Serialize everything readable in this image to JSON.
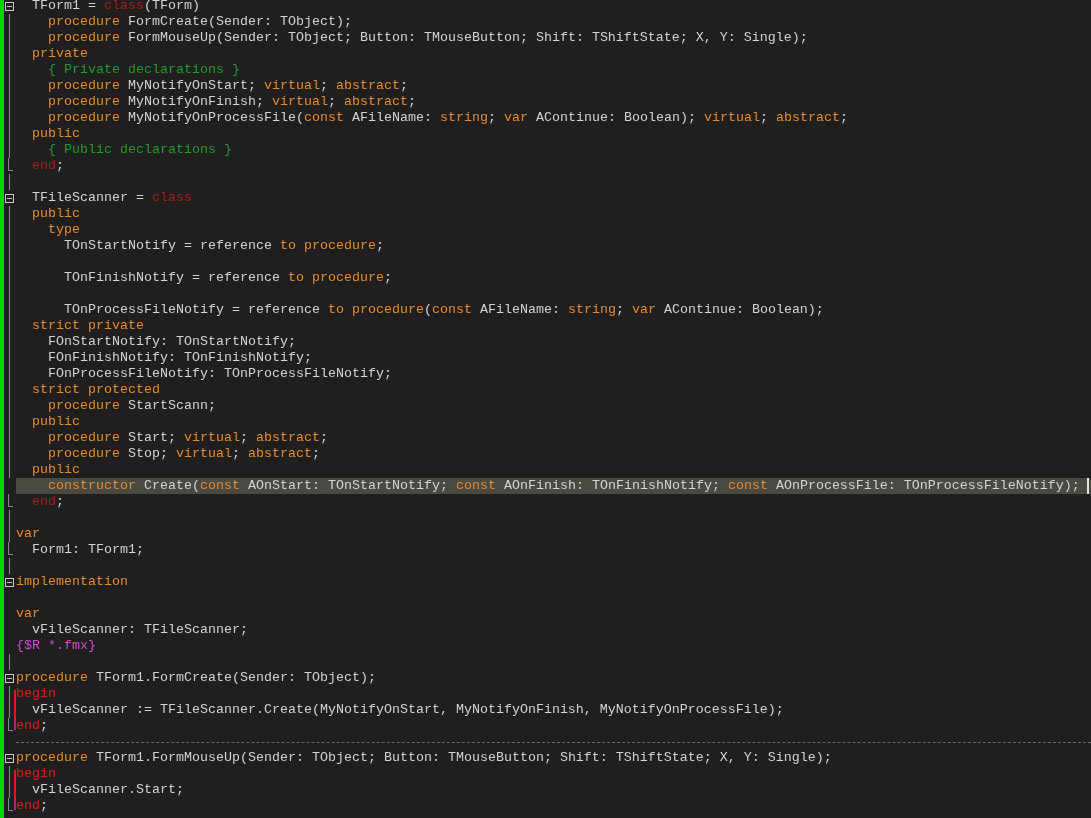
{
  "editor": {
    "lines": [
      {
        "kind": "code",
        "collapsible": true,
        "fold_guide": false,
        "fold_end": false,
        "in_block": false,
        "current": false,
        "tokens": [
          {
            "text": "  TForm1 = ",
            "kind": "plain"
          },
          {
            "text": "class",
            "kind": "reserved"
          },
          {
            "text": "(TForm)",
            "kind": "plain"
          }
        ]
      },
      {
        "kind": "code",
        "collapsible": false,
        "fold_guide": true,
        "fold_end": false,
        "in_block": false,
        "current": false,
        "tokens": [
          {
            "text": "    procedure",
            "kind": "keyword"
          },
          {
            "text": " FormCreate(Sender: TObject);",
            "kind": "plain"
          }
        ]
      },
      {
        "kind": "code",
        "collapsible": false,
        "fold_guide": true,
        "fold_end": false,
        "in_block": false,
        "current": false,
        "tokens": [
          {
            "text": "    procedure",
            "kind": "keyword"
          },
          {
            "text": " FormMouseUp(Sender: TObject; Button: TMouseButton; Shift: TShiftState; X, Y: Single);",
            "kind": "plain"
          }
        ]
      },
      {
        "kind": "code",
        "collapsible": false,
        "fold_guide": true,
        "fold_end": false,
        "in_block": false,
        "current": false,
        "tokens": [
          {
            "text": "  private",
            "kind": "keyword"
          }
        ]
      },
      {
        "kind": "code",
        "collapsible": false,
        "fold_guide": true,
        "fold_end": false,
        "in_block": false,
        "current": false,
        "tokens": [
          {
            "text": "    { Private declarations }",
            "kind": "comment"
          }
        ]
      },
      {
        "kind": "code",
        "collapsible": false,
        "fold_guide": true,
        "fold_end": false,
        "in_block": false,
        "current": false,
        "tokens": [
          {
            "text": "    procedure",
            "kind": "keyword"
          },
          {
            "text": " MyNotifyOnStart; ",
            "kind": "plain"
          },
          {
            "text": "virtual",
            "kind": "keyword"
          },
          {
            "text": "; ",
            "kind": "plain"
          },
          {
            "text": "abstract",
            "kind": "keyword"
          },
          {
            "text": ";",
            "kind": "plain"
          }
        ]
      },
      {
        "kind": "code",
        "collapsible": false,
        "fold_guide": true,
        "fold_end": false,
        "in_block": false,
        "current": false,
        "tokens": [
          {
            "text": "    procedure",
            "kind": "keyword"
          },
          {
            "text": " MyNotifyOnFinish; ",
            "kind": "plain"
          },
          {
            "text": "virtual",
            "kind": "keyword"
          },
          {
            "text": "; ",
            "kind": "plain"
          },
          {
            "text": "abstract",
            "kind": "keyword"
          },
          {
            "text": ";",
            "kind": "plain"
          }
        ]
      },
      {
        "kind": "code",
        "collapsible": false,
        "fold_guide": true,
        "fold_end": false,
        "in_block": false,
        "current": false,
        "tokens": [
          {
            "text": "    procedure",
            "kind": "keyword"
          },
          {
            "text": " MyNotifyOnProcessFile(",
            "kind": "plain"
          },
          {
            "text": "const",
            "kind": "keyword"
          },
          {
            "text": " AFileName: ",
            "kind": "plain"
          },
          {
            "text": "string",
            "kind": "keyword"
          },
          {
            "text": "; ",
            "kind": "plain"
          },
          {
            "text": "var",
            "kind": "keyword"
          },
          {
            "text": " AContinue: Boolean); ",
            "kind": "plain"
          },
          {
            "text": "virtual",
            "kind": "keyword"
          },
          {
            "text": "; ",
            "kind": "plain"
          },
          {
            "text": "abstract",
            "kind": "keyword"
          },
          {
            "text": ";",
            "kind": "plain"
          }
        ]
      },
      {
        "kind": "code",
        "collapsible": false,
        "fold_guide": true,
        "fold_end": false,
        "in_block": false,
        "current": false,
        "tokens": [
          {
            "text": "  public",
            "kind": "keyword"
          }
        ]
      },
      {
        "kind": "code",
        "collapsible": false,
        "fold_guide": true,
        "fold_end": false,
        "in_block": false,
        "current": false,
        "tokens": [
          {
            "text": "    { Public declarations }",
            "kind": "comment"
          }
        ]
      },
      {
        "kind": "code",
        "collapsible": false,
        "fold_guide": false,
        "fold_end": true,
        "in_block": false,
        "current": false,
        "tokens": [
          {
            "text": "  end",
            "kind": "reserved"
          },
          {
            "text": ";",
            "kind": "plain"
          }
        ]
      },
      {
        "kind": "code",
        "collapsible": false,
        "fold_guide": true,
        "fold_end": false,
        "in_block": false,
        "current": false
      },
      {
        "kind": "code",
        "collapsible": true,
        "fold_guide": false,
        "fold_end": false,
        "in_block": false,
        "current": false,
        "tokens": [
          {
            "text": "  TFileScanner = ",
            "kind": "plain"
          },
          {
            "text": "class",
            "kind": "reserved"
          }
        ]
      },
      {
        "kind": "code",
        "collapsible": false,
        "fold_guide": true,
        "fold_end": false,
        "in_block": false,
        "current": false,
        "tokens": [
          {
            "text": "  public",
            "kind": "keyword"
          }
        ]
      },
      {
        "kind": "code",
        "collapsible": false,
        "fold_guide": true,
        "fold_end": false,
        "in_block": false,
        "current": false,
        "tokens": [
          {
            "text": "    type",
            "kind": "keyword"
          }
        ]
      },
      {
        "kind": "code",
        "collapsible": false,
        "fold_guide": true,
        "fold_end": false,
        "in_block": false,
        "current": false,
        "tokens": [
          {
            "text": "      TOnStartNotify = reference ",
            "kind": "plain"
          },
          {
            "text": "to procedure",
            "kind": "keyword"
          },
          {
            "text": ";",
            "kind": "plain"
          }
        ]
      },
      {
        "kind": "code",
        "collapsible": false,
        "fold_guide": true,
        "fold_end": false,
        "in_block": false,
        "current": false
      },
      {
        "kind": "code",
        "collapsible": false,
        "fold_guide": true,
        "fold_end": false,
        "in_block": false,
        "current": false,
        "tokens": [
          {
            "text": "      TOnFinishNotify = reference ",
            "kind": "plain"
          },
          {
            "text": "to procedure",
            "kind": "keyword"
          },
          {
            "text": ";",
            "kind": "plain"
          }
        ]
      },
      {
        "kind": "code",
        "collapsible": false,
        "fold_guide": true,
        "fold_end": false,
        "in_block": false,
        "current": false
      },
      {
        "kind": "code",
        "collapsible": false,
        "fold_guide": true,
        "fold_end": false,
        "in_block": false,
        "current": false,
        "tokens": [
          {
            "text": "      TOnProcessFileNotify = reference ",
            "kind": "plain"
          },
          {
            "text": "to procedure",
            "kind": "keyword"
          },
          {
            "text": "(",
            "kind": "plain"
          },
          {
            "text": "const",
            "kind": "keyword"
          },
          {
            "text": " AFileName: ",
            "kind": "plain"
          },
          {
            "text": "string",
            "kind": "keyword"
          },
          {
            "text": "; ",
            "kind": "plain"
          },
          {
            "text": "var",
            "kind": "keyword"
          },
          {
            "text": " AContinue: Boolean);",
            "kind": "plain"
          }
        ]
      },
      {
        "kind": "code",
        "collapsible": false,
        "fold_guide": true,
        "fold_end": false,
        "in_block": false,
        "current": false,
        "tokens": [
          {
            "text": "  strict private",
            "kind": "keyword"
          }
        ]
      },
      {
        "kind": "code",
        "collapsible": false,
        "fold_guide": true,
        "fold_end": false,
        "in_block": false,
        "current": false,
        "tokens": [
          {
            "text": "    FOnStartNotify: TOnStartNotify;",
            "kind": "plain"
          }
        ]
      },
      {
        "kind": "code",
        "collapsible": false,
        "fold_guide": true,
        "fold_end": false,
        "in_block": false,
        "current": false,
        "tokens": [
          {
            "text": "    FOnFinishNotify: TOnFinishNotify;",
            "kind": "plain"
          }
        ]
      },
      {
        "kind": "code",
        "collapsible": false,
        "fold_guide": true,
        "fold_end": false,
        "in_block": false,
        "current": false,
        "tokens": [
          {
            "text": "    FOnProcessFileNotify: TOnProcessFileNotify;",
            "kind": "plain"
          }
        ]
      },
      {
        "kind": "code",
        "collapsible": false,
        "fold_guide": true,
        "fold_end": false,
        "in_block": false,
        "current": false,
        "tokens": [
          {
            "text": "  strict protected",
            "kind": "keyword"
          }
        ]
      },
      {
        "kind": "code",
        "collapsible": false,
        "fold_guide": true,
        "fold_end": false,
        "in_block": false,
        "current": false,
        "tokens": [
          {
            "text": "    procedure",
            "kind": "keyword"
          },
          {
            "text": " StartScann;",
            "kind": "plain"
          }
        ]
      },
      {
        "kind": "code",
        "collapsible": false,
        "fold_guide": true,
        "fold_end": false,
        "in_block": false,
        "current": false,
        "tokens": [
          {
            "text": "  public",
            "kind": "keyword"
          }
        ]
      },
      {
        "kind": "code",
        "collapsible": false,
        "fold_guide": true,
        "fold_end": false,
        "in_block": false,
        "current": false,
        "tokens": [
          {
            "text": "    procedure",
            "kind": "keyword"
          },
          {
            "text": " Start; ",
            "kind": "plain"
          },
          {
            "text": "virtual",
            "kind": "keyword"
          },
          {
            "text": "; ",
            "kind": "plain"
          },
          {
            "text": "abstract",
            "kind": "keyword"
          },
          {
            "text": ";",
            "kind": "plain"
          }
        ]
      },
      {
        "kind": "code",
        "collapsible": false,
        "fold_guide": true,
        "fold_end": false,
        "in_block": false,
        "current": false,
        "tokens": [
          {
            "text": "    procedure",
            "kind": "keyword"
          },
          {
            "text": " Stop; ",
            "kind": "plain"
          },
          {
            "text": "virtual",
            "kind": "keyword"
          },
          {
            "text": "; ",
            "kind": "plain"
          },
          {
            "text": "abstract",
            "kind": "keyword"
          },
          {
            "text": ";",
            "kind": "plain"
          }
        ]
      },
      {
        "kind": "code",
        "collapsible": false,
        "fold_guide": true,
        "fold_end": false,
        "in_block": false,
        "current": false,
        "tokens": [
          {
            "text": "  public",
            "kind": "keyword"
          }
        ]
      },
      {
        "kind": "code",
        "collapsible": false,
        "fold_guide": false,
        "fold_end": false,
        "in_block": false,
        "current": true,
        "tokens": [
          {
            "text": "    constructor",
            "kind": "keyword"
          },
          {
            "text": " Create(",
            "kind": "plain"
          },
          {
            "text": "const",
            "kind": "keyword"
          },
          {
            "text": " AOnStart: TOnStartNotify; ",
            "kind": "plain"
          },
          {
            "text": "const",
            "kind": "keyword"
          },
          {
            "text": " AOnFinish: TOnFinishNotify; ",
            "kind": "plain"
          },
          {
            "text": "const",
            "kind": "keyword"
          },
          {
            "text": " AOnProcessFile: TOnProcessFileNotify);",
            "kind": "plain"
          }
        ]
      },
      {
        "kind": "code",
        "collapsible": false,
        "fold_guide": false,
        "fold_end": true,
        "in_block": false,
        "current": false,
        "tokens": [
          {
            "text": "  end",
            "kind": "reserved"
          },
          {
            "text": ";",
            "kind": "plain"
          }
        ]
      },
      {
        "kind": "code",
        "collapsible": false,
        "fold_guide": true,
        "fold_end": false,
        "in_block": false,
        "current": false
      },
      {
        "kind": "code",
        "collapsible": false,
        "fold_guide": true,
        "fold_end": false,
        "in_block": false,
        "current": false,
        "tokens": [
          {
            "text": "var",
            "kind": "keyword"
          }
        ]
      },
      {
        "kind": "code",
        "collapsible": false,
        "fold_guide": false,
        "fold_end": true,
        "in_block": false,
        "current": false,
        "tokens": [
          {
            "text": "  Form1: TForm1;",
            "kind": "plain"
          }
        ]
      },
      {
        "kind": "code",
        "collapsible": false,
        "fold_guide": true,
        "fold_end": false,
        "in_block": false,
        "current": false
      },
      {
        "kind": "code",
        "collapsible": true,
        "fold_guide": false,
        "fold_end": false,
        "in_block": false,
        "current": false,
        "tokens": [
          {
            "text": "implementation",
            "kind": "keyword"
          }
        ]
      },
      {
        "kind": "code",
        "collapsible": false,
        "fold_guide": false,
        "fold_end": false,
        "in_block": false,
        "current": false
      },
      {
        "kind": "code",
        "collapsible": false,
        "fold_guide": false,
        "fold_end": false,
        "in_block": false,
        "current": false,
        "tokens": [
          {
            "text": "var",
            "kind": "keyword"
          }
        ]
      },
      {
        "kind": "code",
        "collapsible": false,
        "fold_guide": false,
        "fold_end": false,
        "in_block": false,
        "current": false,
        "tokens": [
          {
            "text": "  vFileScanner: TFileScanner;",
            "kind": "plain"
          }
        ]
      },
      {
        "kind": "code",
        "collapsible": false,
        "fold_guide": false,
        "fold_end": false,
        "in_block": false,
        "current": false,
        "tokens": [
          {
            "text": "{$R *.fmx}",
            "kind": "directive"
          }
        ]
      },
      {
        "kind": "code",
        "collapsible": false,
        "fold_guide": true,
        "fold_end": false,
        "in_block": false,
        "current": false
      },
      {
        "kind": "code",
        "collapsible": true,
        "fold_guide": false,
        "fold_end": false,
        "in_block": false,
        "current": false,
        "tokens": [
          {
            "text": "procedure",
            "kind": "keyword"
          },
          {
            "text": " TForm1.FormCreate(Sender: TObject);",
            "kind": "plain"
          }
        ]
      },
      {
        "kind": "code",
        "collapsible": false,
        "fold_guide": true,
        "fold_end": false,
        "in_block": true,
        "current": false,
        "tokens": [
          {
            "text": "begin",
            "kind": "block"
          }
        ]
      },
      {
        "kind": "code",
        "collapsible": false,
        "fold_guide": true,
        "fold_end": false,
        "in_block": true,
        "current": false,
        "tokens": [
          {
            "text": "  vFileScanner := TFileScanner.Create(MyNotifyOnStart, MyNotifyOnFinish, MyNotifyOnProcessFile);",
            "kind": "plain"
          }
        ]
      },
      {
        "kind": "code",
        "collapsible": false,
        "fold_guide": false,
        "fold_end": true,
        "in_block": true,
        "current": false,
        "tokens": [
          {
            "text": "end",
            "kind": "block"
          },
          {
            "text": ";",
            "kind": "plain"
          }
        ]
      },
      {
        "kind": "separator"
      },
      {
        "kind": "code",
        "collapsible": true,
        "fold_guide": false,
        "fold_end": false,
        "in_block": false,
        "current": false,
        "tokens": [
          {
            "text": "procedure",
            "kind": "keyword"
          },
          {
            "text": " TForm1.FormMouseUp(Sender: TObject; Button: TMouseButton; Shift: TShiftState; X, Y: Single);",
            "kind": "plain"
          }
        ]
      },
      {
        "kind": "code",
        "collapsible": false,
        "fold_guide": true,
        "fold_end": false,
        "in_block": true,
        "current": false,
        "tokens": [
          {
            "text": "begin",
            "kind": "block"
          }
        ]
      },
      {
        "kind": "code",
        "collapsible": false,
        "fold_guide": true,
        "fold_end": false,
        "in_block": true,
        "current": false,
        "tokens": [
          {
            "text": "  vFileScanner.Start;",
            "kind": "plain"
          }
        ]
      },
      {
        "kind": "code",
        "collapsible": false,
        "fold_guide": false,
        "fold_end": true,
        "in_block": true,
        "current": false,
        "tokens": [
          {
            "text": "end",
            "kind": "block"
          },
          {
            "text": ";",
            "kind": "plain"
          }
        ]
      }
    ]
  }
}
